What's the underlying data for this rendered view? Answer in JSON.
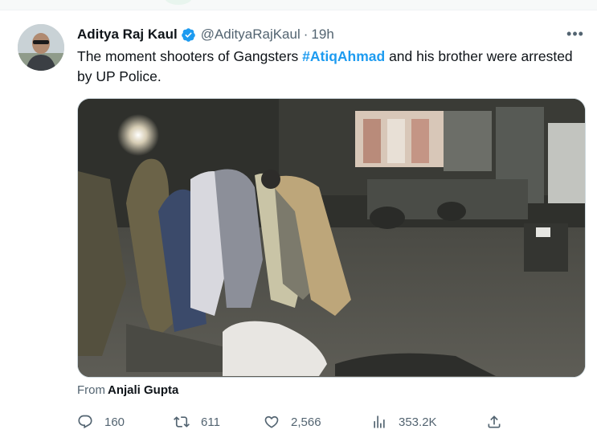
{
  "tweet": {
    "author_name": "Aditya Raj Kaul",
    "handle": "@AdityaRajKaul",
    "separator": "·",
    "time": "19h",
    "more_label": "•••",
    "text_before": "The moment shooters of Gangsters ",
    "hashtag": "#AtiqAhmad",
    "text_after": " and his brother were arrested by UP Police.",
    "from_label": "From",
    "from_author": "Anjali Gupta"
  },
  "actions": {
    "replies": "160",
    "retweets": "611",
    "likes": "2,566",
    "views": "353.2K"
  },
  "icons": {
    "verified": "verified-badge-icon",
    "reply": "reply-icon",
    "retweet": "retweet-icon",
    "like": "heart-icon",
    "views": "analytics-icon",
    "share": "share-icon"
  },
  "colors": {
    "accent": "#1d9bf0",
    "secondary_text": "#536471",
    "primary_text": "#0f1419"
  }
}
